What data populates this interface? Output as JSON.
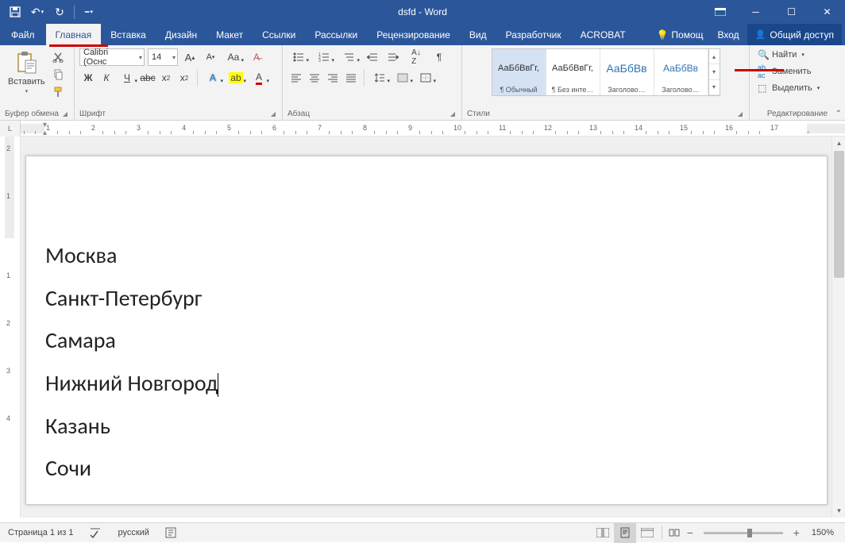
{
  "title": "dsfd - Word",
  "tabs": {
    "file": "Файл",
    "items": [
      "Главная",
      "Вставка",
      "Дизайн",
      "Макет",
      "Ссылки",
      "Рассылки",
      "Рецензирование",
      "Вид",
      "Разработчик",
      "ACROBAT"
    ],
    "active": "Главная",
    "tell_me": "Помощ",
    "signin": "Вход",
    "share": "Общий доступ"
  },
  "ribbon": {
    "clipboard": {
      "paste": "Вставить",
      "label": "Буфер обмена"
    },
    "font": {
      "name": "Calibri (Оснс",
      "size": "14",
      "label": "Шрифт"
    },
    "paragraph": {
      "label": "Абзац"
    },
    "styles": {
      "label": "Стили",
      "preview_text": "АаБбВвГг,",
      "preview_text_big": "АаБбВв",
      "items": [
        {
          "name": "¶ Обычный",
          "sel": true,
          "big": false
        },
        {
          "name": "¶ Без инте…",
          "sel": false,
          "big": false
        },
        {
          "name": "Заголово…",
          "sel": false,
          "big": true
        },
        {
          "name": "Заголово…",
          "sel": false,
          "big": true
        }
      ]
    },
    "editing": {
      "find": "Найти",
      "replace": "Заменить",
      "select": "Выделить",
      "label": "Редактирование"
    }
  },
  "document": {
    "paragraphs": [
      "Москва",
      "Санкт-Петербург",
      "Самара",
      "Нижний Новгород",
      "Казань",
      "Сочи"
    ],
    "cursor_after_index": 3
  },
  "status": {
    "page_info": "Страница 1 из 1",
    "language": "русский",
    "zoom": "150%"
  },
  "ruler_h_numbers": [
    "1",
    "2",
    "3",
    "4",
    "5",
    "6",
    "7",
    "8",
    "9",
    "10",
    "11",
    "12",
    "13",
    "14",
    "15",
    "16",
    "17"
  ],
  "ruler_v_numbers": [
    "2",
    "1",
    "1",
    "2",
    "3",
    "4"
  ]
}
